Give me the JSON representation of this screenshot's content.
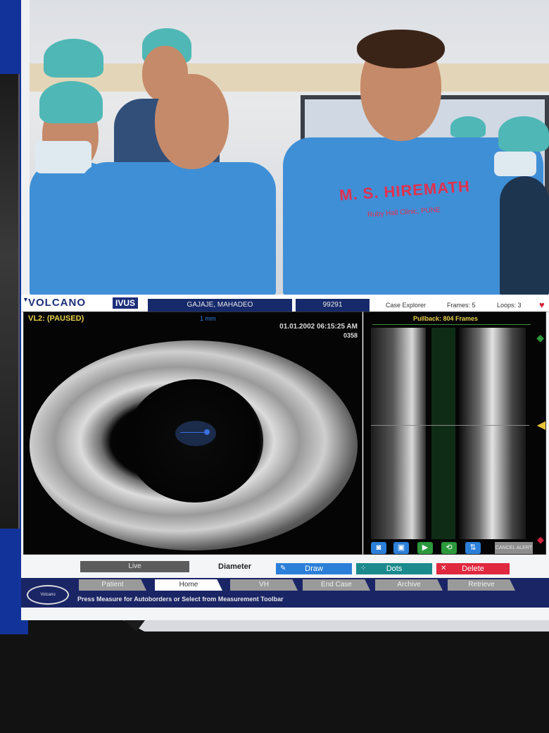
{
  "app": {
    "brand": "VOLCANO",
    "brand_product": "IVUS"
  },
  "header": {
    "patient_name": "GAJAJE, MAHADEO",
    "patient_id": "99291",
    "case_explorer": "Case Explorer",
    "frames": "Frames: 5",
    "loops": "Loops: 3"
  },
  "video": {
    "gown_name": "M. S. HIREMATH",
    "gown_subtitle": "Ruby Hall Clinic, PUNE"
  },
  "main_view": {
    "status": "VL2: (PAUSED)",
    "frame_badge": "1 mm",
    "timestamp": "01.01.2002 06:15:25 AM",
    "frame_number": "0358"
  },
  "long_view": {
    "pullback": "Pullback: 804 Frames",
    "cancel_label": "CANCEL ALERT"
  },
  "measure": {
    "live_label": "Live",
    "mode_label": "Diameter",
    "draw_label": "Draw",
    "dots_label": "Dots",
    "delete_label": "Delete"
  },
  "nav": {
    "logo_text": "Volcano",
    "tabs": [
      "Patient",
      "Home",
      "VH",
      "End Case",
      "Archive",
      "Retrieve"
    ],
    "hint": "Press Measure for Autoborders or Select from Measurement Toolbar"
  },
  "colors": {
    "brand_blue": "#1b2e7a",
    "nav_bar": "#1a2566",
    "status_yellow": "#e8d04a",
    "draw_blue": "#2c7fd9",
    "dots_teal": "#1b8a8c",
    "delete_red": "#e0283e"
  },
  "icons": [
    "heart-icon",
    "pointer-icon",
    "scroll-up-icon",
    "scroll-down-icon",
    "camera-icon",
    "play-icon",
    "loop-icon",
    "pencil-icon"
  ]
}
